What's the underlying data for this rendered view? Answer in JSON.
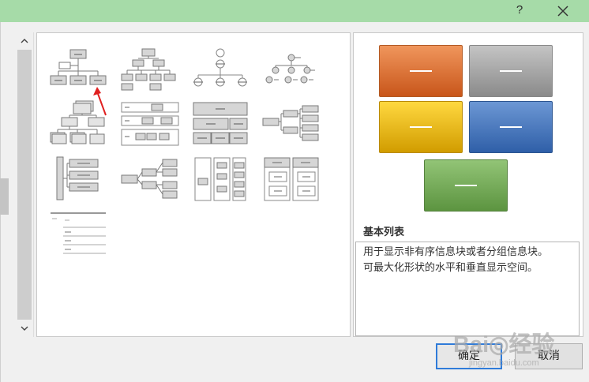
{
  "titlebar": {
    "help_label": "?",
    "close_icon": "close-icon",
    "background": "#a6dba8"
  },
  "gallery": {
    "items": [
      {
        "id": "hierarchy-basic",
        "icon": "org-chart-icon"
      },
      {
        "id": "hierarchy-labeled",
        "icon": "labeled-hierarchy-icon"
      },
      {
        "id": "circle-hierarchy",
        "icon": "circle-hierarchy-icon"
      },
      {
        "id": "circle-node-hierarchy",
        "icon": "circle-node-hierarchy-icon"
      },
      {
        "id": "stacked-hierarchy",
        "icon": "stacked-hierarchy-icon"
      },
      {
        "id": "table-hierarchy",
        "icon": "table-hierarchy-icon"
      },
      {
        "id": "table-list",
        "icon": "table-list-icon"
      },
      {
        "id": "horizontal-hierarchy",
        "icon": "horizontal-hierarchy-icon"
      },
      {
        "id": "lined-list",
        "icon": "lined-list-icon"
      },
      {
        "id": "horizontal-org-chart",
        "icon": "horizontal-org-chart-icon"
      },
      {
        "id": "vertical-columns",
        "icon": "vertical-columns-icon"
      },
      {
        "id": "labeled-columns",
        "icon": "labeled-columns-icon"
      },
      {
        "id": "bullet-hierarchy",
        "icon": "bullet-hierarchy-icon"
      }
    ]
  },
  "preview": {
    "colors": {
      "orange": "#d86a2a",
      "gray": "#9e9e9e",
      "yellow": "#ecb800",
      "blue": "#3d6fb8",
      "green": "#6aa84f"
    },
    "layout_name": "基本列表",
    "description_line1": "用于显示非有序信息块或者分组信息块。",
    "description_line2": "可最大化形状的水平和垂直显示空间。"
  },
  "buttons": {
    "ok": "确定",
    "cancel": "取消"
  },
  "watermark": {
    "text": "Bai◎经验",
    "sub": "jingyan.baidu.com"
  },
  "annotation": {
    "arrow_color": "#e02020"
  }
}
